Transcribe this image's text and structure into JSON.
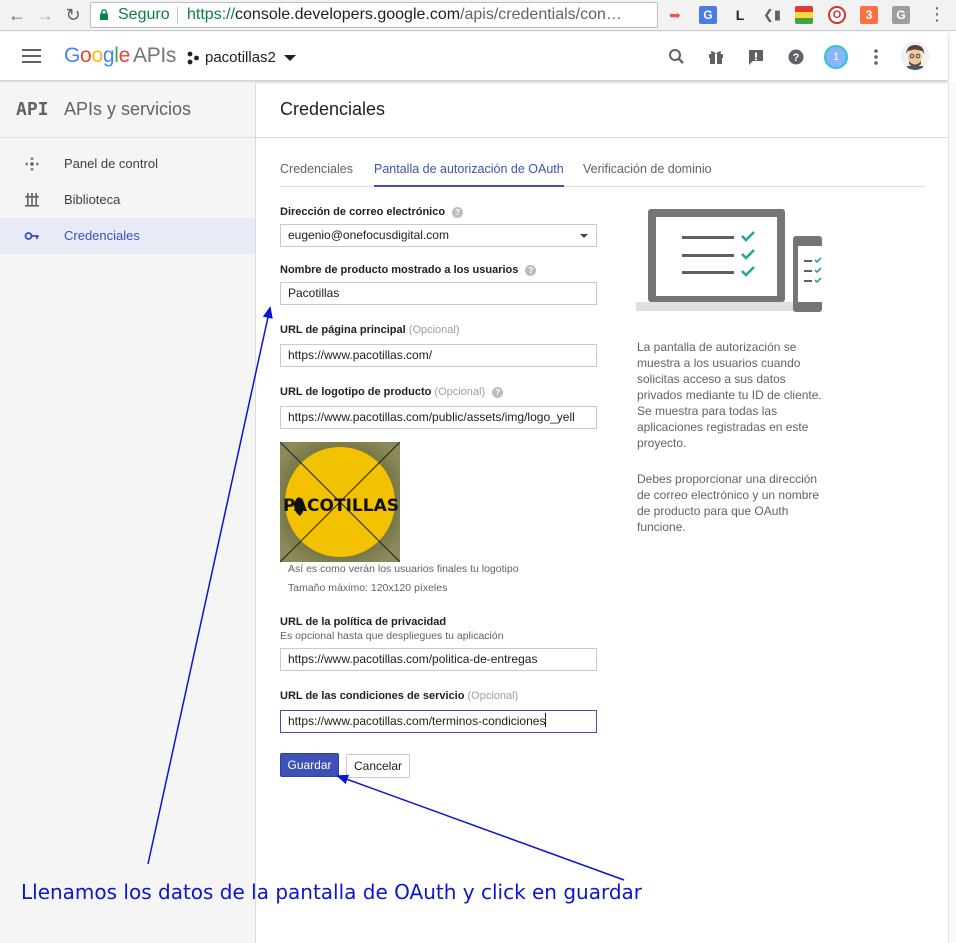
{
  "browser": {
    "secure_label": "Seguro",
    "url_scheme": "https://",
    "url_host": "console.developers.google.com",
    "url_path": "/apis/credentials/con…"
  },
  "header": {
    "logo_google": "Google",
    "logo_apis": "APIs",
    "project_name": "pacotillas2",
    "notification_count": "1"
  },
  "sidebar": {
    "glyph": "API",
    "title": "APIs y servicios",
    "items": [
      {
        "label": "Panel de control",
        "icon": "dashboard-icon"
      },
      {
        "label": "Biblioteca",
        "icon": "library-icon"
      },
      {
        "label": "Credenciales",
        "icon": "key-icon",
        "active": true
      }
    ]
  },
  "main": {
    "title": "Credenciales",
    "tabs": [
      {
        "label": "Credenciales"
      },
      {
        "label": "Pantalla de autorización de OAuth",
        "active": true
      },
      {
        "label": "Verificación de dominio"
      }
    ]
  },
  "form": {
    "email_label": "Dirección de correo electrónico",
    "email_value": "eugenio@onefocusdigital.com",
    "product_label": "Nombre de producto mostrado a los usuarios",
    "product_value": "Pacotillas",
    "homepage_label": "URL de página principal",
    "homepage_optional": "(Opcional)",
    "homepage_value": "https://www.pacotillas.com/",
    "logo_label": "URL de logotipo de producto",
    "logo_optional": "(Opcional)",
    "logo_value": "https://www.pacotillas.com/public/assets/img/logo_yell",
    "logo_image_text": "PACOTILLAS",
    "logo_note_1": "Así es como verán los usuarios finales tu logotipo",
    "logo_note_2": "Tamaño máximo: 120x120 píxeles",
    "privacy_label": "URL de la política de privacidad",
    "privacy_sub": "Es opcional hasta que despliegues tu aplicación",
    "privacy_value": "https://www.pacotillas.com/politica-de-entregas",
    "terms_label": "URL de las condiciones de servicio",
    "terms_optional": "(Opcional)",
    "terms_value": "https://www.pacotillas.com/terminos-condiciones",
    "save_label": "Guardar",
    "cancel_label": "Cancelar"
  },
  "info": {
    "paragraph_1": "La pantalla de autorización se muestra a los usuarios cuando solicitas acceso a sus datos privados mediante tu ID de cliente. Se muestra para todas las aplicaciones registradas en este proyecto.",
    "paragraph_2": "Debes proporcionar una dirección de correo electrónico y un nombre de producto para que OAuth funcione."
  },
  "annotation": {
    "text": "Llenamos los datos de la pantalla de OAuth y click en guardar",
    "color": "#0b14d6"
  },
  "colors": {
    "accent": "#3f51b5",
    "secure_green": "#0b8043",
    "illustration_check": "#26a69a"
  }
}
